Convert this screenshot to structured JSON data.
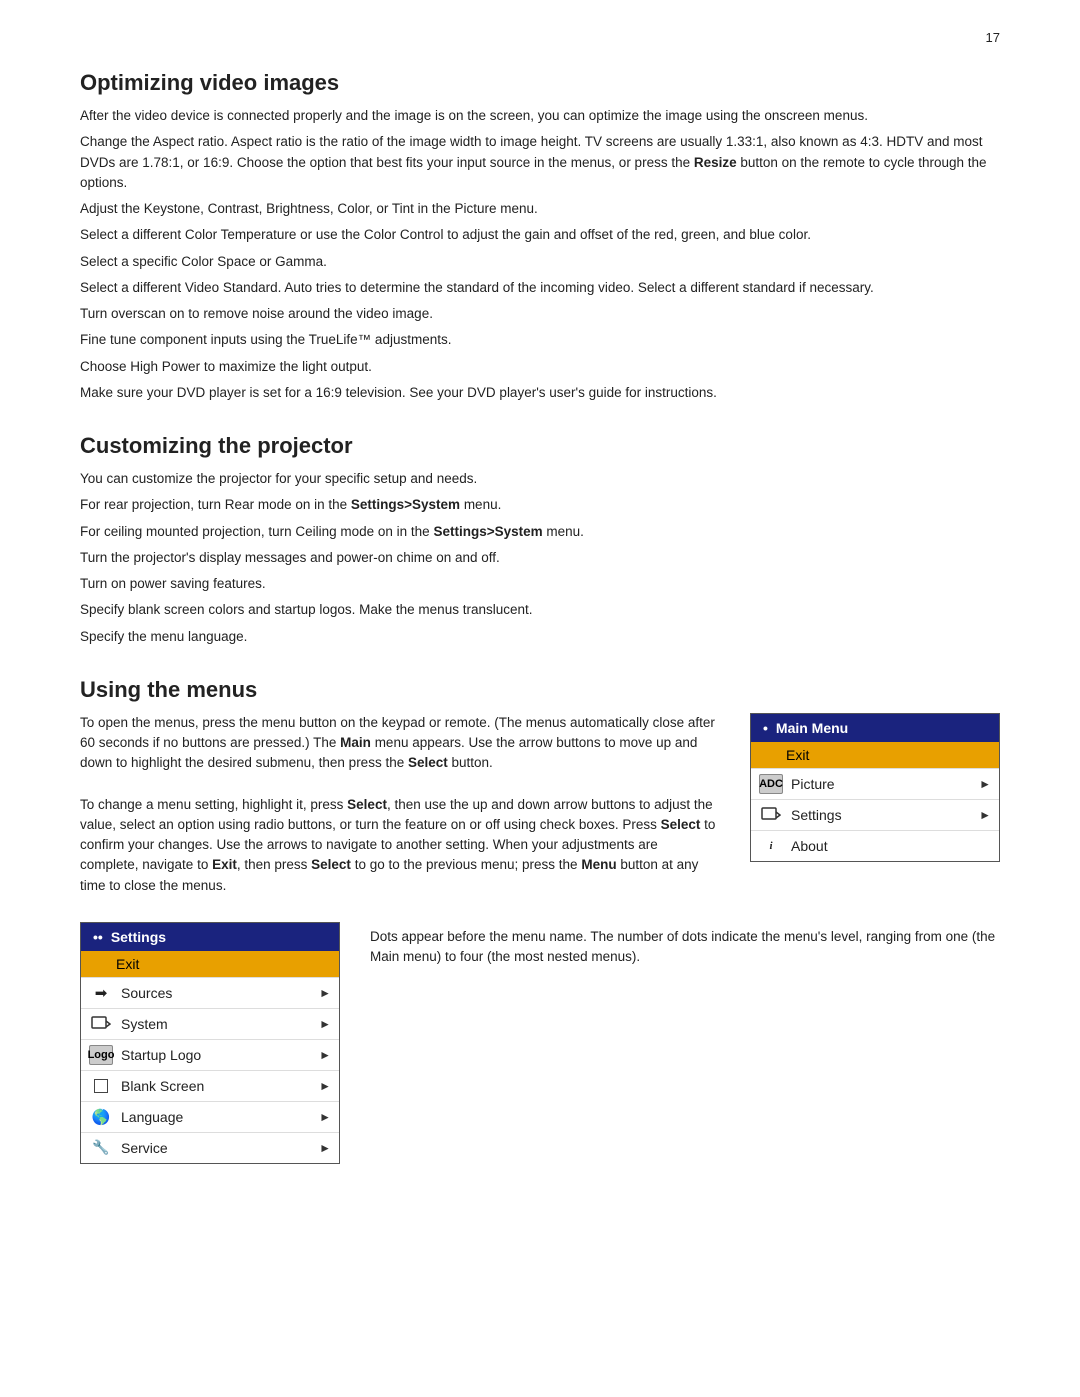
{
  "page": {
    "number": "17"
  },
  "section1": {
    "title": "Optimizing video images",
    "paragraphs": [
      "After the video device is connected properly and the image is on the screen, you can optimize the image using the onscreen menus.",
      "Change the Aspect ratio. Aspect ratio is the ratio of the image width to image height. TV screens are usually 1.33:1, also known as 4:3. HDTV and most DVDs are 1.78:1, or 16:9. Choose the option that best fits your input source in the menus, or press the Resize button on the remote to cycle through the options.",
      "Adjust the Keystone, Contrast, Brightness, Color, or Tint in the Picture menu.",
      "Select a different Color Temperature or use the Color Control to adjust the gain and offset of the red, green, and blue color.",
      "Select a specific Color Space or Gamma.",
      "Select a different Video Standard. Auto tries to determine the standard of the incoming video. Select a different standard if necessary.",
      "Turn overscan on to remove noise around the video image.",
      "Fine tune component inputs using the TrueLife™ adjustments.",
      "Choose High Power to maximize the light output.",
      "Make sure your DVD player is set for a 16:9 television. See your DVD player's user's guide for instructions."
    ],
    "bold_words": [
      "Resize"
    ]
  },
  "section2": {
    "title": "Customizing the projector",
    "paragraphs": [
      "You can customize the projector for your specific setup and needs.",
      "For rear projection, turn Rear mode on in the Settings>System menu.",
      "For ceiling mounted projection, turn Ceiling mode on in the Settings>System menu.",
      "Turn the projector's display messages and power-on chime on and off.",
      "Turn on power saving features.",
      "Specify blank screen colors and startup logos. Make the menus translucent.",
      "Specify the menu language."
    ],
    "bold_words_1": [
      "Settings>System"
    ],
    "bold_words_2": [
      "Settings>System"
    ]
  },
  "section3": {
    "title": "Using the menus",
    "left_paragraphs": [
      "To open the menus, press the menu button on the keypad or remote. (The menus automatically close after 60 seconds if no buttons are pressed.) The Main menu appears. Use the arrow buttons to move up and down to highlight the desired submenu, then press the Select button.",
      "To change a menu setting, highlight it, press Select, then use the up and down arrow buttons to adjust the value, select an option using radio buttons, or turn the feature on or off using check boxes. Press Select to confirm your changes. Use the arrows to navigate to another setting. When your adjustments are complete, navigate to Exit, then press Select to go to the previous menu; press the Menu button at any time to close the menus."
    ],
    "bold_words": [
      "Main",
      "Select",
      "Select",
      "Select",
      "Exit",
      "Select",
      "Menu"
    ],
    "main_menu": {
      "header": "Main Menu",
      "header_dots": "•",
      "exit_label": "Exit",
      "items": [
        {
          "icon_type": "adc",
          "icon_text": "ADC",
          "label": "Picture",
          "has_arrow": true
        },
        {
          "icon_type": "settings",
          "icon_text": "⊟▶",
          "label": "Settings",
          "has_arrow": true
        },
        {
          "icon_type": "info",
          "icon_text": "i",
          "label": "About",
          "has_arrow": false
        }
      ]
    },
    "dots_description": "Dots appear before the menu name. The number of dots indicate the menu's level, ranging from one (the Main menu) to four (the most nested menus).",
    "settings_menu": {
      "header": "Settings",
      "header_dots": "••",
      "exit_label": "Exit",
      "items": [
        {
          "icon_type": "source",
          "icon_text": "⇒",
          "label": "Sources",
          "has_arrow": true
        },
        {
          "icon_type": "system",
          "icon_text": "⊟▶",
          "label": "System",
          "has_arrow": true
        },
        {
          "icon_type": "logo",
          "icon_text": "Logo",
          "label": "Startup Logo",
          "has_arrow": true
        },
        {
          "icon_type": "blank",
          "icon_text": "",
          "label": "Blank Screen",
          "has_arrow": true
        },
        {
          "icon_type": "globe",
          "icon_text": "🌐",
          "label": "Language",
          "has_arrow": true
        },
        {
          "icon_type": "wrench",
          "icon_text": "🔧",
          "label": "Service",
          "has_arrow": true
        }
      ]
    }
  }
}
